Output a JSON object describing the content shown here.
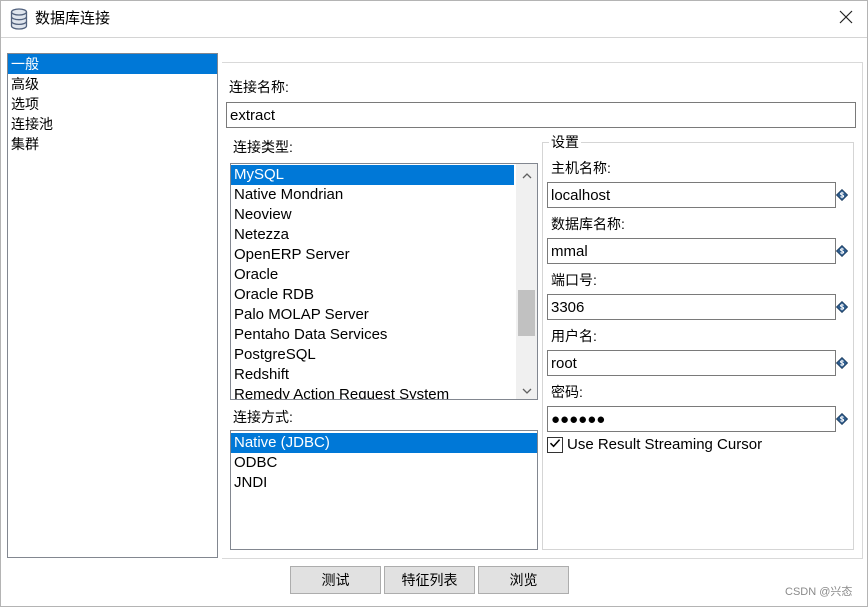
{
  "window": {
    "title": "数据库连接"
  },
  "sidebar": {
    "items": [
      {
        "label": "一般",
        "selected": true
      },
      {
        "label": "高级",
        "selected": false
      },
      {
        "label": "选项",
        "selected": false
      },
      {
        "label": "连接池",
        "selected": false
      },
      {
        "label": "集群",
        "selected": false
      }
    ]
  },
  "general": {
    "connection_name": {
      "label": "连接名称:",
      "value": "extract"
    },
    "connection_type": {
      "label": "连接类型:",
      "items": [
        {
          "label": "MySQL",
          "selected": true
        },
        {
          "label": "Native Mondrian",
          "selected": false
        },
        {
          "label": "Neoview",
          "selected": false
        },
        {
          "label": "Netezza",
          "selected": false
        },
        {
          "label": "OpenERP Server",
          "selected": false
        },
        {
          "label": "Oracle",
          "selected": false
        },
        {
          "label": "Oracle RDB",
          "selected": false
        },
        {
          "label": "Palo MOLAP Server",
          "selected": false
        },
        {
          "label": "Pentaho Data Services",
          "selected": false
        },
        {
          "label": "PostgreSQL",
          "selected": false
        },
        {
          "label": "Redshift",
          "selected": false
        },
        {
          "label": "Remedy Action Request System",
          "selected": false
        }
      ]
    },
    "access": {
      "label": "连接方式:",
      "items": [
        {
          "label": "Native (JDBC)",
          "selected": true
        },
        {
          "label": "ODBC",
          "selected": false
        },
        {
          "label": "JNDI",
          "selected": false
        }
      ]
    },
    "settings": {
      "legend": "设置",
      "host": {
        "label": "主机名称:",
        "value": "localhost"
      },
      "database": {
        "label": "数据库名称:",
        "value": "mmal"
      },
      "port": {
        "label": "端口号:",
        "value": "3306"
      },
      "username": {
        "label": "用户名:",
        "value": "root"
      },
      "password": {
        "label": "密码:",
        "value": "●●●●●●"
      },
      "streaming_cursor": {
        "label": "Use Result Streaming Cursor",
        "checked": true
      }
    }
  },
  "buttons": {
    "test": "测试",
    "feature_list": "特征列表",
    "explore": "浏览"
  },
  "watermark": "CSDN @兴态",
  "icons": {
    "window": "database-icon",
    "close": "close-icon",
    "scroll_up": "chevron-up-icon",
    "scroll_down": "chevron-down-icon",
    "variable": "variable-icon",
    "checkbox": "checkmark-icon"
  },
  "colors": {
    "selection": "#0078d7",
    "selection_text": "#ffffff",
    "button_face": "#e1e1e1",
    "button_border": "#adadad",
    "list_border": "#828790"
  }
}
